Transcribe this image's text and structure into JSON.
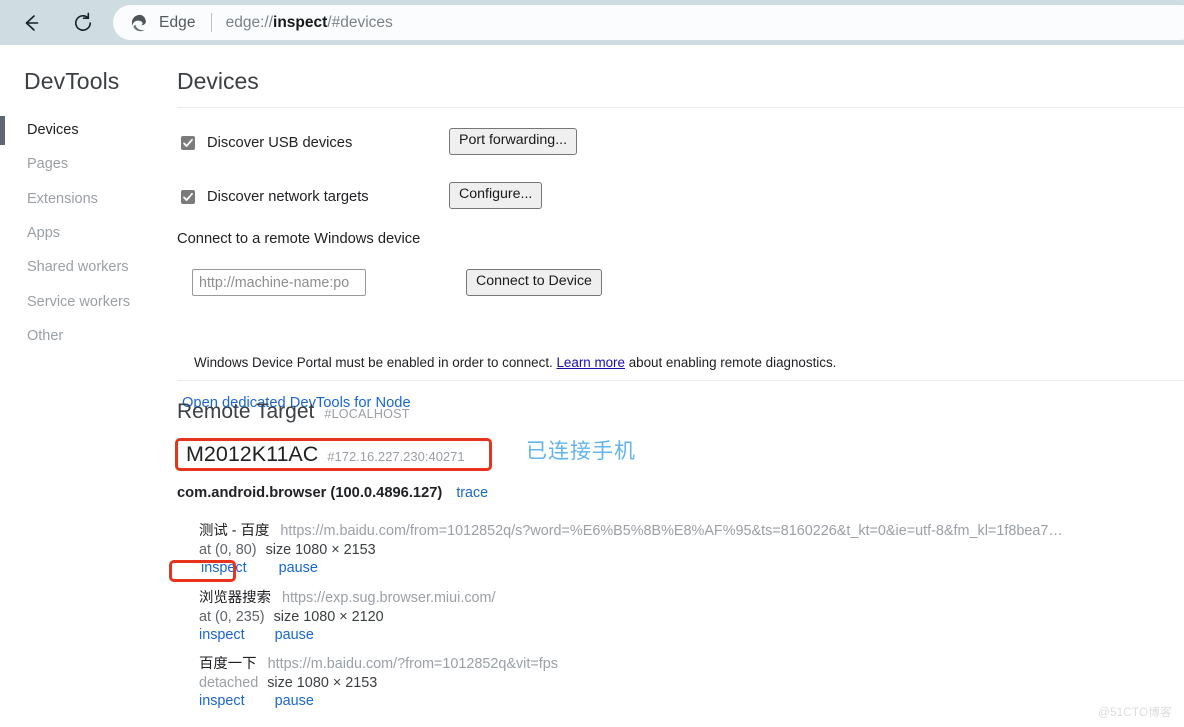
{
  "browser": {
    "back_icon": "arrow-left-icon",
    "reload_icon": "reload-icon",
    "brand_icon": "edge-logo-icon",
    "brand_label": "Edge",
    "url_prefix": "edge://",
    "url_bold": "inspect",
    "url_suffix": "/#devices",
    "url_full": "edge://inspect/#devices",
    "omnibox_tail_glyph": "∧"
  },
  "sidebar": {
    "brand": "DevTools",
    "items": [
      {
        "label": "Devices",
        "active": true
      },
      {
        "label": "Pages",
        "active": false
      },
      {
        "label": "Extensions",
        "active": false
      },
      {
        "label": "Apps",
        "active": false
      },
      {
        "label": "Shared workers",
        "active": false
      },
      {
        "label": "Service workers",
        "active": false
      },
      {
        "label": "Other",
        "active": false
      }
    ]
  },
  "main": {
    "page_title": "Devices",
    "discover_usb": {
      "label": "Discover USB devices",
      "checked": true,
      "button": "Port forwarding..."
    },
    "discover_network": {
      "label": "Discover network targets",
      "checked": true,
      "button": "Configure..."
    },
    "remote_windows": {
      "label": "Connect to a remote Windows device",
      "input_placeholder": "http://machine-name:po",
      "input_value": "",
      "button": "Connect to Device",
      "note_before": "Windows Device Portal must be enabled in order to connect. ",
      "note_link": "Learn more",
      "note_after": " about enabling remote diagnostics."
    },
    "node_link": "Open dedicated DevTools for Node"
  },
  "remote_target": {
    "title": "Remote Target",
    "host": "#LOCALHOST",
    "device_name": "M2012K11AC",
    "device_address": "#172.16.227.230:40271",
    "annotation_cn": "已连接手机",
    "package_name": "com.android.browser (100.0.4896.127)",
    "trace_label": "trace",
    "targets": [
      {
        "title": "测试 - 百度",
        "url": "https://m.baidu.com/from=1012852q/s?word=%E6%B5%8B%E8%AF%95&ts=8160226&t_kt=0&ie=utf-8&fm_kl=1f8bea7…",
        "state": "at (0, 80)",
        "state_kind": "at",
        "size": "size 1080 × 2153",
        "inspect_label": "inspect",
        "pause_label": "pause",
        "inspect_highlighted": true
      },
      {
        "title": "浏览器搜索",
        "url": "https://exp.sug.browser.miui.com/",
        "state": "at (0, 235)",
        "state_kind": "at",
        "size": "size 1080 × 2120",
        "inspect_label": "inspect",
        "pause_label": "pause",
        "inspect_highlighted": false
      },
      {
        "title": "百度一下",
        "url": "https://m.baidu.com/?from=1012852q&vit=fps",
        "state": "detached",
        "state_kind": "detached",
        "size": "size 1080 × 2153",
        "inspect_label": "inspect",
        "pause_label": "pause",
        "inspect_highlighted": false
      }
    ]
  },
  "watermark": "@51CTO博客",
  "colors": {
    "chrome_bg": "#cfdde2",
    "omnibox_bg": "#fafcfd",
    "link_blue": "#1967d2",
    "annotation_red": "#e8331c",
    "annotation_blue": "#62b4f0",
    "active_bar": "#5f6571"
  }
}
